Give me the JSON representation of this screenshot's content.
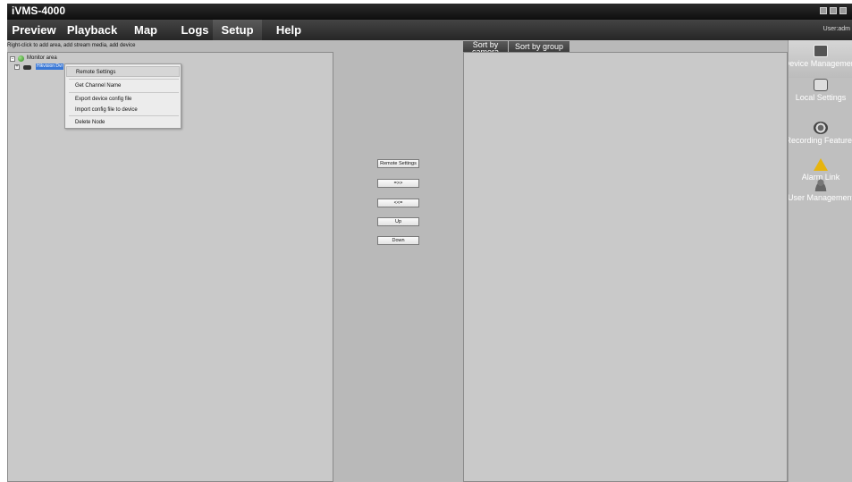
{
  "app": {
    "title": "iVMS-4000",
    "user": "User:adm"
  },
  "menu": [
    "Preview",
    "Playback",
    "Map",
    "Logs",
    "Setup",
    "Help"
  ],
  "hint": "Right-click to add area, add stream media, add device",
  "tree": {
    "root": "Monitor area",
    "device": "Hikvision Dvr"
  },
  "context_menu": [
    "Remote Settings",
    "Get Channel Name",
    "Export device config file",
    "Import config file to device",
    "Delete Node"
  ],
  "middle_buttons": [
    "Remote Settings",
    "=>>",
    "<<=",
    "Up",
    "Down"
  ],
  "right_tabs": [
    "Sort by camera",
    "Sort by group"
  ],
  "sidebar": [
    "Device Management",
    "Local Settings",
    "Recording Features",
    "Alarm Link",
    "User Management"
  ]
}
